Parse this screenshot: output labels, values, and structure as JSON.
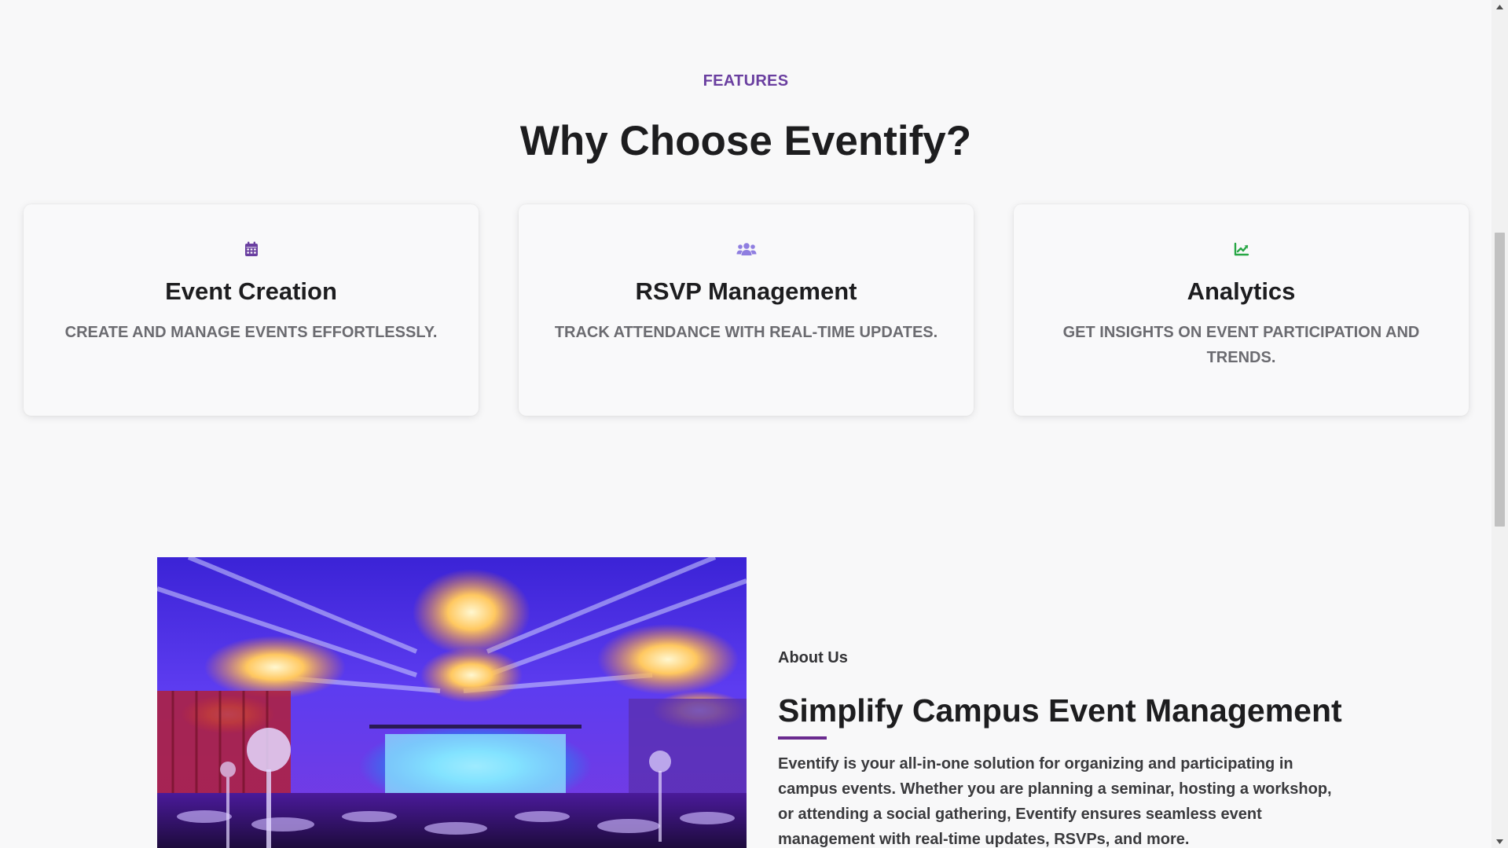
{
  "features": {
    "eyebrow": "FEATURES",
    "title": "Why Choose Eventify?",
    "cards": [
      {
        "icon": "calendar-icon",
        "icon_color": "#6a3fa0",
        "title": "Event Creation",
        "description": "CREATE AND MANAGE EVENTS EFFORTLESSLY."
      },
      {
        "icon": "users-icon",
        "icon_color": "#8f7ee0",
        "title": "RSVP Management",
        "description": "TRACK ATTENDANCE WITH REAL-TIME UPDATES."
      },
      {
        "icon": "chart-line-icon",
        "icon_color": "#28a745",
        "title": "Analytics",
        "description": "GET INSIGHTS ON EVENT PARTICIPATION AND TRENDS."
      }
    ]
  },
  "about": {
    "image_alt": "ballroom-event-photo",
    "eyebrow": "About Us",
    "title": "Simplify Campus Event Management",
    "body": "Eventify is your all-in-one solution for organizing and participating in campus events. Whether you are planning a seminar, hosting a workshop, or attending a social gathering, Eventify ensures seamless event management with real-time updates, RSVPs, and more.",
    "accent_color": "#6a2a8f"
  }
}
